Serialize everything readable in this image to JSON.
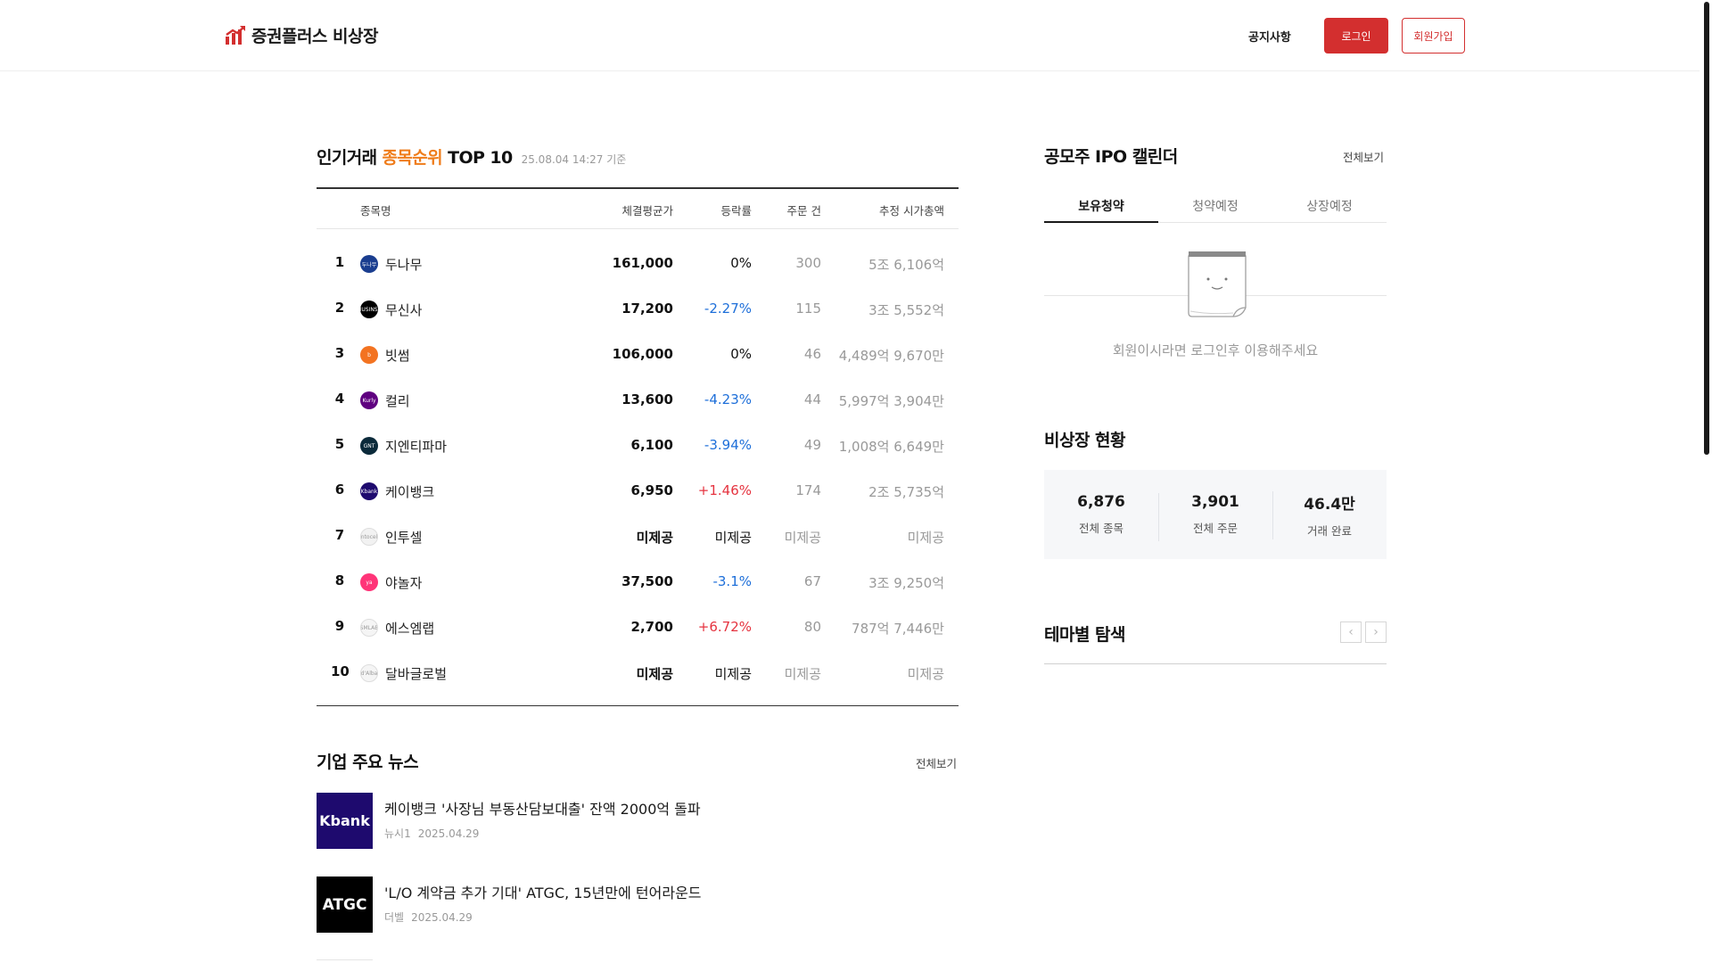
{
  "header": {
    "logo_text": "증권플러스 비상장",
    "notice": "공지사항",
    "login": "로그인",
    "signup": "회원가입"
  },
  "ranking": {
    "title_pre": "인기거래",
    "title_accent": "종목순위",
    "title_post": "TOP 10",
    "timestamp": "25.08.04 14:27 기준",
    "columns": [
      "종목명",
      "체결평균가",
      "등락률",
      "주문 건",
      "추정 시가총액"
    ],
    "rows": [
      {
        "rank": "1",
        "name": "두나무",
        "price": "161,000",
        "rate": "0%",
        "dir": "flat",
        "orders": "300",
        "cap": "5조 6,106억",
        "logo_color": "#1a3d8f",
        "logo_text": "두나무"
      },
      {
        "rank": "2",
        "name": "무신사",
        "price": "17,200",
        "rate": "-2.27%",
        "dir": "down",
        "orders": "115",
        "cap": "3조 5,552억",
        "logo_color": "#000000",
        "logo_text": "MUSINSA"
      },
      {
        "rank": "3",
        "name": "빗썸",
        "price": "106,000",
        "rate": "0%",
        "dir": "flat",
        "orders": "46",
        "cap": "4,489억 9,670만",
        "logo_color": "#f37321",
        "logo_text": "b"
      },
      {
        "rank": "4",
        "name": "컬리",
        "price": "13,600",
        "rate": "-4.23%",
        "dir": "down",
        "orders": "44",
        "cap": "5,997억 3,904만",
        "logo_color": "#5f0080",
        "logo_text": "Kurly"
      },
      {
        "rank": "5",
        "name": "지엔티파마",
        "price": "6,100",
        "rate": "-3.94%",
        "dir": "down",
        "orders": "49",
        "cap": "1,008억 6,649만",
        "logo_color": "#0b2a3a",
        "logo_text": "GNT"
      },
      {
        "rank": "6",
        "name": "케이뱅크",
        "price": "6,950",
        "rate": "+1.46%",
        "dir": "up",
        "orders": "174",
        "cap": "2조 5,735억",
        "logo_color": "#1e0a6e",
        "logo_text": "Kbank"
      },
      {
        "rank": "7",
        "name": "인투셀",
        "price": "미제공",
        "rate": "미제공",
        "dir": "na",
        "orders": "미제공",
        "cap": "미제공",
        "logo_color": "#f2f2f2",
        "logo_text": "intocell"
      },
      {
        "rank": "8",
        "name": "야놀자",
        "price": "37,500",
        "rate": "-3.1%",
        "dir": "down",
        "orders": "67",
        "cap": "3조 9,250억",
        "logo_color": "#ff3478",
        "logo_text": "ya"
      },
      {
        "rank": "9",
        "name": "에스엠랩",
        "price": "2,700",
        "rate": "+6.72%",
        "dir": "up",
        "orders": "80",
        "cap": "787억 7,446만",
        "logo_color": "#f5f5f5",
        "logo_text": "SMLAB"
      },
      {
        "rank": "10",
        "name": "달바글로벌",
        "price": "미제공",
        "rate": "미제공",
        "dir": "na",
        "orders": "미제공",
        "cap": "미제공",
        "logo_color": "#f5f5f5",
        "logo_text": "d'Alba"
      }
    ]
  },
  "news": {
    "title": "기업 주요 뉴스",
    "more": "전체보기",
    "items": [
      {
        "headline": "케이뱅크 '사장님 부동산담보대출' 잔액 2000억 돌파",
        "source": "뉴시1",
        "date": "2025.04.29",
        "thumb_text": "Kbank",
        "thumb_color": "#1e0a6e"
      },
      {
        "headline": "'L/O 계약금 추가 기대' ATGC, 15년만에 턴어라운드",
        "source": "더벨",
        "date": "2025.04.29",
        "thumb_text": "ATGC",
        "thumb_color": "#000000"
      }
    ]
  },
  "ipo": {
    "title": "공모주 IPO 캘린더",
    "more": "전체보기",
    "tabs": [
      "보유청약",
      "청약예정",
      "상장예정"
    ],
    "active_tab": 0,
    "empty_message": "회원이시라면 로그인후 이용해주세요"
  },
  "stats": {
    "title": "비상장 현황",
    "items": [
      {
        "value": "6,876",
        "label": "전체 종목"
      },
      {
        "value": "3,901",
        "label": "전체 주문"
      },
      {
        "value": "46.4만",
        "label": "거래 완료"
      }
    ]
  },
  "theme": {
    "title": "테마별 탐색",
    "prev": "‹",
    "next": "›"
  },
  "colors": {
    "brand_red": "#d32f2f",
    "accent_orange": "#ef7c1a",
    "down_blue": "#1e6fd9",
    "up_red": "#e5333f"
  }
}
